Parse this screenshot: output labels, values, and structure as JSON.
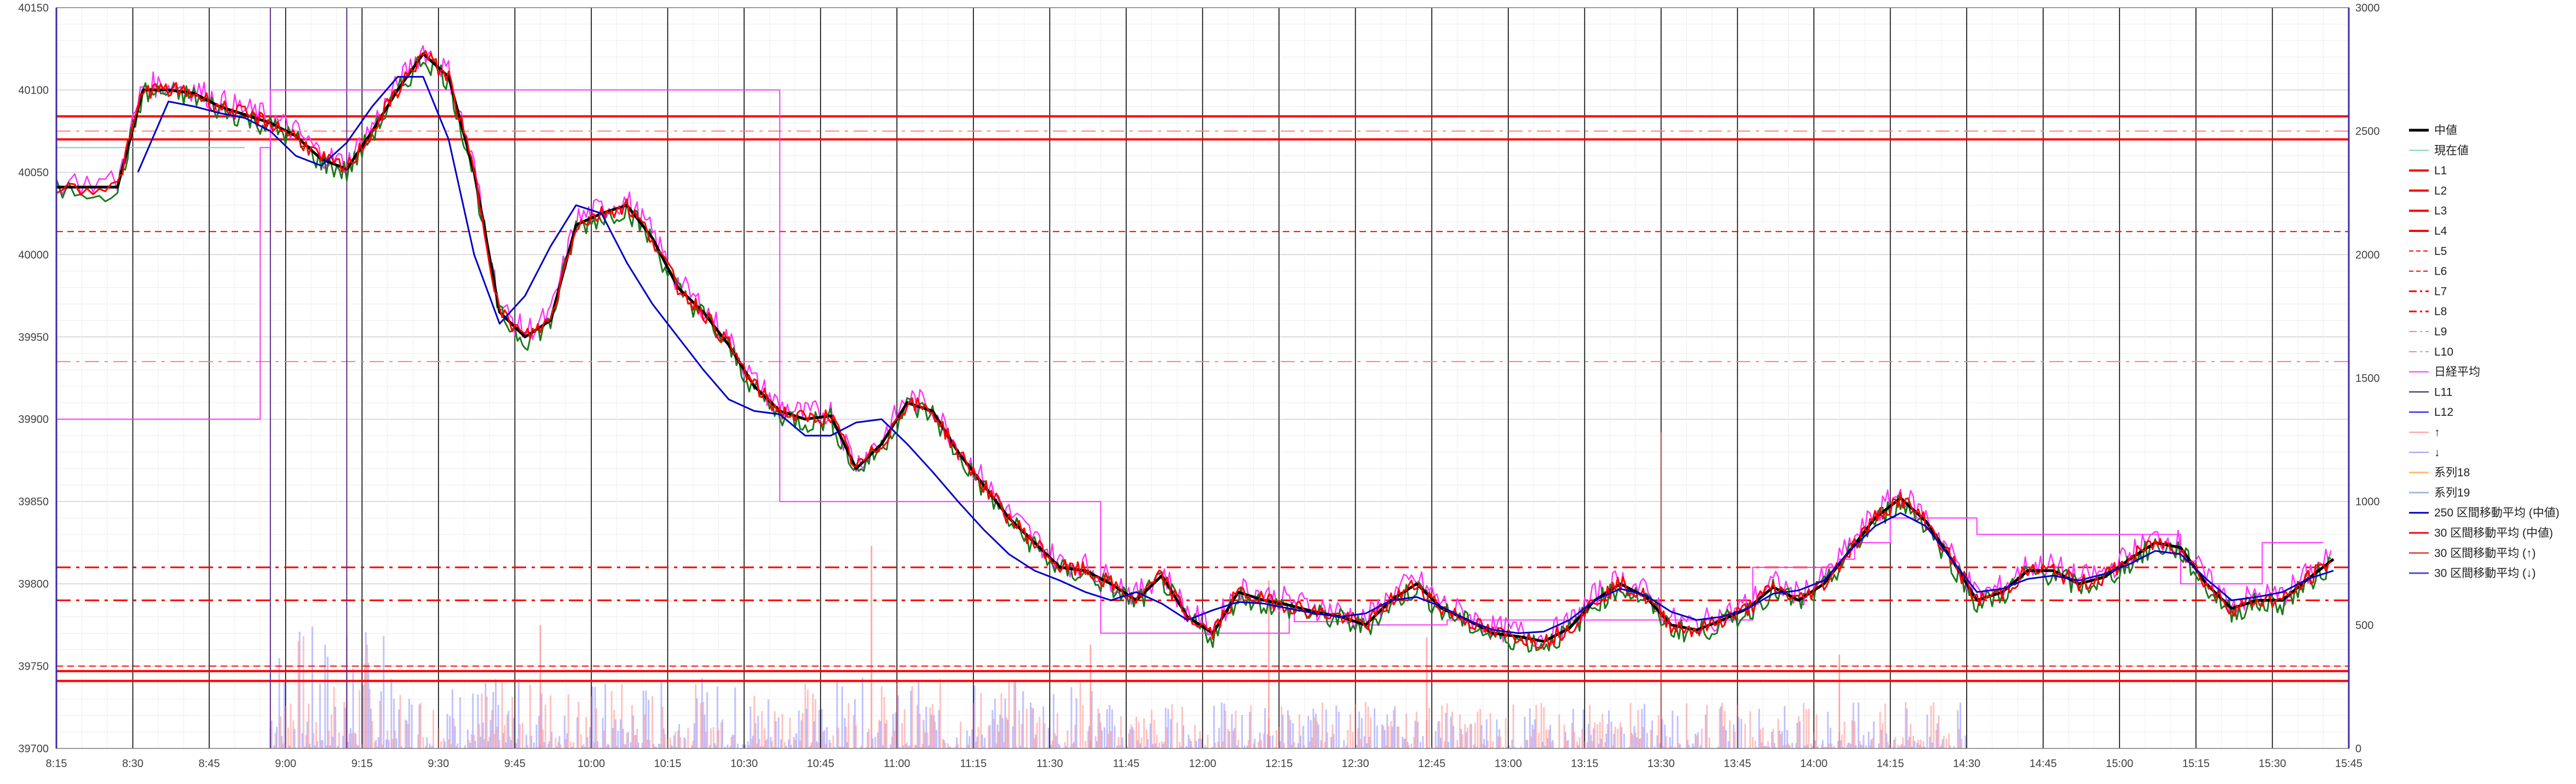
{
  "chart_data": {
    "type": "line",
    "title": "",
    "xlabel": "",
    "ylabel": "",
    "ylim": [
      39700,
      40150
    ],
    "y2lim": [
      0,
      3000
    ],
    "y_ticks": [
      "39700",
      "39750",
      "39800",
      "39850",
      "39900",
      "39950",
      "40000",
      "40050",
      "40100",
      "40150"
    ],
    "y2_ticks": [
      "0",
      "500",
      "1000",
      "1500",
      "2000",
      "2500",
      "3000"
    ],
    "x_ticks": [
      "8:15",
      "8:30",
      "8:45",
      "9:00",
      "9:15",
      "9:30",
      "9:45",
      "10:00",
      "10:15",
      "10:30",
      "10:45",
      "11:00",
      "11:15",
      "11:30",
      "11:45",
      "12:00",
      "12:15",
      "12:30",
      "12:45",
      "13:00",
      "13:15",
      "13:30",
      "13:45",
      "14:00",
      "14:15",
      "14:30",
      "14:45",
      "15:00",
      "15:15",
      "15:30",
      "15:45"
    ],
    "x_range_minutes": [
      495,
      945
    ],
    "legend_position": "right",
    "grid": true,
    "series": [
      {
        "name": "中値",
        "color": "#000000",
        "style": "solid",
        "width": 5,
        "x": [
          495,
          507,
          512,
          517,
          522,
          527,
          532,
          537,
          542,
          547,
          552,
          557,
          562,
          567,
          572,
          577,
          582,
          587,
          592,
          597,
          602,
          607,
          612,
          617,
          622,
          627,
          632,
          637,
          642,
          647,
          652,
          657,
          662,
          667,
          672,
          677,
          682,
          687,
          692,
          697,
          702,
          707,
          712,
          717,
          722,
          727,
          732,
          737,
          742,
          747,
          752,
          757,
          762,
          767,
          772,
          777,
          782,
          787,
          792,
          797,
          802,
          807,
          812,
          817,
          822,
          827,
          832,
          837,
          842,
          847,
          852,
          857,
          862,
          867,
          872,
          877,
          882,
          887,
          892,
          897,
          902,
          907,
          912,
          917,
          922,
          927,
          932,
          937,
          942
        ],
        "y": [
          40041,
          40041,
          40100,
          40100,
          40098,
          40090,
          40085,
          40080,
          40072,
          40058,
          40052,
          40075,
          40100,
          40122,
          40108,
          40050,
          39965,
          39950,
          39960,
          40018,
          40025,
          40030,
          40010,
          39980,
          39965,
          39945,
          39920,
          39905,
          39900,
          39902,
          39870,
          39885,
          39910,
          39905,
          39880,
          39860,
          39840,
          39825,
          39810,
          39808,
          39800,
          39790,
          39805,
          39780,
          39770,
          39795,
          39790,
          39787,
          39783,
          39780,
          39775,
          39790,
          39800,
          39785,
          39778,
          39770,
          39768,
          39765,
          39773,
          39790,
          39800,
          39792,
          39775,
          39772,
          39778,
          39785,
          39798,
          39790,
          39800,
          39820,
          39840,
          39852,
          39838,
          39815,
          39790,
          39795,
          39808,
          39808,
          39800,
          39804,
          39815,
          39825,
          39822,
          39800,
          39785,
          39790,
          39790,
          39803,
          39815
        ]
      },
      {
        "name": "現在値",
        "color": "#7fd3b5",
        "style": "solid",
        "width": 2,
        "x": [
          495,
          532
        ],
        "y": [
          40065,
          40065
        ]
      },
      {
        "name": "L1",
        "color": "#ff0000",
        "style": "solid",
        "width": 4,
        "value": 40084
      },
      {
        "name": "L2",
        "color": "#ff0000",
        "style": "solid",
        "width": 4,
        "value": 40070
      },
      {
        "name": "L3",
        "color": "#ff0000",
        "style": "solid",
        "width": 4,
        "value": 39747
      },
      {
        "name": "L4",
        "color": "#ff0000",
        "style": "solid",
        "width": 4,
        "value": 39741
      },
      {
        "name": "L5",
        "color": "#ff0000",
        "style": "dash",
        "width": 2,
        "value": 40014
      },
      {
        "name": "L6",
        "color": "#ff0000",
        "style": "dash",
        "width": 2,
        "value": 39750
      },
      {
        "name": "L7",
        "color": "#ff0000",
        "style": "dashdot",
        "width": 3,
        "value": 39810
      },
      {
        "name": "L8",
        "color": "#ff0000",
        "style": "dashdot",
        "width": 3,
        "value": 39790
      },
      {
        "name": "L9",
        "color": "#ff8080",
        "style": "dashdot",
        "width": 2,
        "value": 40075
      },
      {
        "name": "L10",
        "color": "#ff8080",
        "style": "dashdot",
        "width": 2,
        "value": 39935
      },
      {
        "name": "日経平均",
        "color": "#ff33ff",
        "style": "solid",
        "width": 2,
        "x": [
          495,
          535,
          535,
          537,
          537,
          637,
          637,
          700,
          700,
          737,
          737,
          738,
          738,
          750,
          750,
          768,
          768,
          828,
          828,
          845,
          845,
          848,
          848,
          855,
          855,
          872,
          872,
          912,
          912,
          928,
          928,
          940
        ],
        "y": [
          39900,
          39900,
          40065,
          40065,
          40100,
          40100,
          39850,
          39850,
          39770,
          39770,
          39785,
          39785,
          39777,
          39777,
          39775,
          39775,
          39778,
          39778,
          39810,
          39810,
          39815,
          39815,
          39825,
          39825,
          39840,
          39840,
          39830,
          39830,
          39800,
          39800,
          39825,
          39825
        ]
      },
      {
        "name": "L11",
        "color": "#1f1f5f",
        "style": "solid",
        "width": 2
      },
      {
        "name": "L12",
        "color": "#0000ff",
        "style": "solid",
        "width": 2
      },
      {
        "name": "↑",
        "color": "#ff9999",
        "style": "solid",
        "width": 2
      },
      {
        "name": "↓",
        "color": "#9999ff",
        "style": "solid",
        "width": 2
      },
      {
        "name": "系列18",
        "color": "#ffbb77",
        "style": "solid",
        "width": 3
      },
      {
        "name": "系列19",
        "color": "#a6b8e6",
        "style": "solid",
        "width": 3
      },
      {
        "name": "250 区間移動平均 (中値)",
        "color": "#0000c8",
        "style": "solid",
        "width": 3,
        "x": [
          511,
          517,
          522,
          527,
          532,
          537,
          542,
          547,
          552,
          557,
          562,
          567,
          572,
          577,
          582,
          587,
          592,
          597,
          602,
          607,
          612,
          617,
          622,
          627,
          632,
          637,
          642,
          647,
          652,
          657,
          662,
          667,
          672,
          677,
          682,
          687,
          692,
          697,
          702,
          707,
          712,
          717,
          722,
          727,
          732,
          737,
          742,
          747,
          752,
          757,
          762,
          767,
          772,
          777,
          782,
          787,
          792,
          797,
          802,
          807,
          812,
          817,
          822,
          827,
          832,
          837,
          842,
          847,
          852,
          857,
          862,
          867,
          872,
          877,
          882,
          887,
          892,
          897,
          902,
          907,
          912,
          917,
          922,
          927,
          932,
          937,
          942
        ],
        "y": [
          40050,
          40093,
          40090,
          40086,
          40083,
          40075,
          40060,
          40054,
          40068,
          40090,
          40108,
          40108,
          40070,
          40000,
          39958,
          39975,
          40005,
          40030,
          40025,
          39995,
          39970,
          39950,
          39930,
          39912,
          39905,
          39903,
          39890,
          39890,
          39898,
          39900,
          39885,
          39868,
          39850,
          39833,
          39818,
          39808,
          39802,
          39795,
          39790,
          39795,
          39788,
          39778,
          39784,
          39789,
          39788,
          39785,
          39782,
          39780,
          39782,
          39790,
          39792,
          39786,
          39778,
          39772,
          39770,
          39771,
          39778,
          39790,
          39797,
          39793,
          39783,
          39778,
          39780,
          39785,
          39794,
          39796,
          39802,
          39820,
          39835,
          39843,
          39835,
          39815,
          39795,
          39797,
          39803,
          39805,
          39802,
          39806,
          39812,
          39820,
          39818,
          39803,
          39790,
          39792,
          39795,
          39803,
          39808
        ]
      },
      {
        "name": "30 区間移動平均 (中値)",
        "color": "#ff0000",
        "style": "solid",
        "width": 3
      },
      {
        "name": "30 区間移動平均 (↑)",
        "color": "#e05050",
        "style": "solid",
        "width": 3
      },
      {
        "name": "30 区間移動平均 (↓)",
        "color": "#5050e0",
        "style": "solid",
        "width": 3
      }
    ]
  }
}
